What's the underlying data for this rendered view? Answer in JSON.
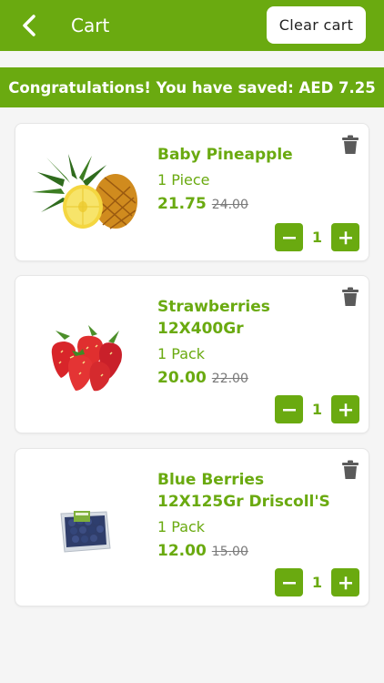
{
  "header": {
    "title": "Cart",
    "clear_label": "Clear cart"
  },
  "banner": {
    "text": "Congratulations! You have saved: AED 7.25"
  },
  "items": [
    {
      "name": "Baby Pineapple",
      "unit": "1 Piece",
      "price": "21.75",
      "old_price": "24.00",
      "quantity": "1",
      "image_icon": "pineapple-image"
    },
    {
      "name": "Strawberries 12X400Gr",
      "unit": "1 Pack",
      "price": "20.00",
      "old_price": "22.00",
      "quantity": "1",
      "image_icon": "strawberries-image"
    },
    {
      "name": "Blue Berries 12X125Gr Driscoll'S",
      "unit": "1 Pack",
      "price": "12.00",
      "old_price": "15.00",
      "quantity": "1",
      "image_icon": "blueberries-image"
    }
  ],
  "colors": {
    "brand_green": "#6aaa10",
    "trash_gray": "#5a5a5a"
  }
}
